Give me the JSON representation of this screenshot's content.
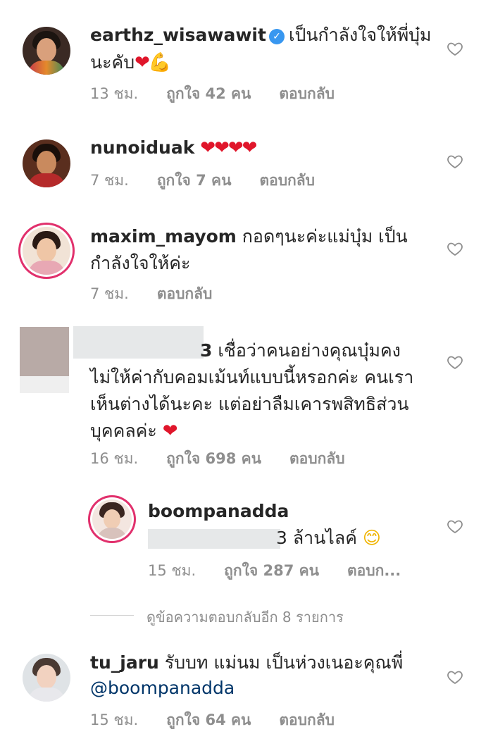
{
  "comments": [
    {
      "username": "earthz_wisawawit",
      "verified": true,
      "text_line1": "เป็นกำลังใจให้พี่บุ๋ม",
      "text_line2": "นะคับ",
      "emoji": "❤💪",
      "time": "13 ชม.",
      "likes": "ถูกใจ 42 คน",
      "reply": "ตอบกลับ"
    },
    {
      "username": "nunoiduak",
      "text_line1": "",
      "emoji": "❤❤❤❤",
      "time": "7 ชม.",
      "likes": "ถูกใจ 7 คน",
      "reply": "ตอบกลับ"
    },
    {
      "username": "maxim_mayom",
      "text_line1": "กอดๆนะค่ะแม่บุ๋ม เป็น",
      "text_line2": "กำลังใจให้ค่ะ",
      "time": "7 ชม.",
      "reply": "ตอบกลับ"
    },
    {
      "username_tail": "3",
      "text_line1": "เชื่อว่าคนอย่างคุณบุ๋มคง",
      "text_line2": "ไม่ให้ค่ากับคอมเม้นท์แบบนี้หรอกค่ะ คนเรา",
      "text_line3": "เห็นต่างได้นะคะ แต่อย่าลืมเคารพสิทธิส่วน",
      "text_line4": "บุคคลค่ะ",
      "emoji": "❤",
      "time": "16 ชม.",
      "likes": "ถูกใจ 698 คน",
      "reply": "ตอบกลับ"
    },
    {
      "username": "boompanadda",
      "text_tail": "3 ล้านไลค์",
      "emoji": "😊",
      "time": "15 ชม.",
      "likes": "ถูกใจ 287 คน",
      "reply": "ตอบก..."
    },
    {
      "username": "tu_jaru",
      "text_line1": "รับบท แม่นม เป็นห่วงเนอะคุณพี่",
      "mention": "@boompanadda",
      "time": "15 ชม.",
      "likes": "ถูกใจ 64 คน",
      "reply": "ตอบกลับ"
    }
  ],
  "view_replies": "ดูข้อความตอบกลับอีก 8 รายการ",
  "colors": {
    "text": "#262626",
    "meta": "#8e8e8e",
    "mention": "#003569",
    "heart": "#e0162b",
    "verified": "#3897f0"
  },
  "icons": {
    "like": "heart-outline-icon",
    "verified": "verified-badge-icon"
  }
}
